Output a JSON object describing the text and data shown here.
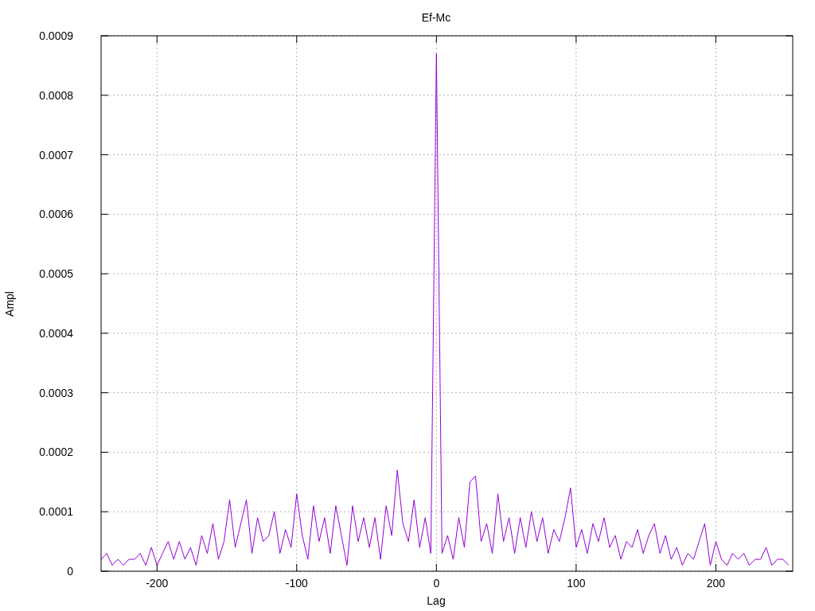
{
  "chart_data": {
    "type": "line",
    "grid": true,
    "title": "Ef-Mc",
    "xlabel": "Lag",
    "ylabel": "Ampl",
    "xlim": [
      -240,
      255
    ],
    "ylim": [
      0,
      0.0009
    ],
    "xticks": [
      -200,
      -100,
      0,
      100,
      200
    ],
    "yticks": [
      {
        "value": 0,
        "label": "0"
      },
      {
        "value": 0.0001,
        "label": "0.0001"
      },
      {
        "value": 0.0002,
        "label": "0.0002"
      },
      {
        "value": 0.0003,
        "label": "0.0003"
      },
      {
        "value": 0.0004,
        "label": "0.0004"
      },
      {
        "value": 0.0005,
        "label": "0.0005"
      },
      {
        "value": 0.0006,
        "label": "0.0006"
      },
      {
        "value": 0.0007,
        "label": "0.0007"
      },
      {
        "value": 0.0008,
        "label": "0.0008"
      },
      {
        "value": 0.0009,
        "label": "0.0009"
      }
    ],
    "x": [
      -240,
      -236,
      -232,
      -228,
      -224,
      -220,
      -216,
      -212,
      -208,
      -204,
      -200,
      -196,
      -192,
      -188,
      -184,
      -180,
      -176,
      -172,
      -168,
      -164,
      -160,
      -156,
      -152,
      -148,
      -144,
      -140,
      -136,
      -132,
      -128,
      -124,
      -120,
      -116,
      -112,
      -108,
      -104,
      -100,
      -96,
      -92,
      -88,
      -84,
      -80,
      -76,
      -72,
      -68,
      -64,
      -60,
      -56,
      -52,
      -48,
      -44,
      -40,
      -36,
      -32,
      -28,
      -24,
      -20,
      -16,
      -12,
      -8,
      -4,
      0,
      4,
      8,
      12,
      16,
      20,
      24,
      28,
      32,
      36,
      40,
      44,
      48,
      52,
      56,
      60,
      64,
      68,
      72,
      76,
      80,
      84,
      88,
      92,
      96,
      100,
      104,
      108,
      112,
      116,
      120,
      124,
      128,
      132,
      136,
      140,
      144,
      148,
      152,
      156,
      160,
      164,
      168,
      172,
      176,
      180,
      184,
      188,
      192,
      196,
      200,
      204,
      208,
      212,
      216,
      220,
      224,
      228,
      232,
      236,
      240,
      244,
      248,
      252
    ],
    "series": [
      {
        "color": "#9400d3",
        "values": [
          2e-05,
          3e-05,
          1e-05,
          2e-05,
          1e-05,
          2e-05,
          2e-05,
          3e-05,
          1e-05,
          4e-05,
          1e-05,
          3e-05,
          5e-05,
          2e-05,
          5e-05,
          2e-05,
          4e-05,
          1e-05,
          6e-05,
          3e-05,
          8e-05,
          2e-05,
          5e-05,
          0.00012,
          4e-05,
          8e-05,
          0.00012,
          3e-05,
          9e-05,
          5e-05,
          6e-05,
          0.0001,
          3e-05,
          7e-05,
          4e-05,
          0.00013,
          6e-05,
          2e-05,
          0.00011,
          5e-05,
          9e-05,
          3e-05,
          0.00011,
          6e-05,
          1e-05,
          0.00011,
          5e-05,
          9e-05,
          4e-05,
          9e-05,
          2e-05,
          0.00011,
          6e-05,
          0.00017,
          8e-05,
          5e-05,
          0.00012,
          4e-05,
          9e-05,
          3e-05,
          0.00087,
          3e-05,
          6e-05,
          2e-05,
          9e-05,
          4e-05,
          0.00015,
          0.00016,
          5e-05,
          8e-05,
          3e-05,
          0.00013,
          5e-05,
          9e-05,
          3e-05,
          9e-05,
          4e-05,
          0.0001,
          5e-05,
          9e-05,
          3e-05,
          7e-05,
          5e-05,
          9e-05,
          0.00014,
          4e-05,
          7e-05,
          3e-05,
          8e-05,
          5e-05,
          9e-05,
          4e-05,
          6e-05,
          2e-05,
          5e-05,
          4e-05,
          7e-05,
          3e-05,
          6e-05,
          8e-05,
          3e-05,
          6e-05,
          2e-05,
          4e-05,
          1e-05,
          3e-05,
          2e-05,
          5e-05,
          8e-05,
          1e-05,
          5e-05,
          2e-05,
          1e-05,
          3e-05,
          2e-05,
          3e-05,
          1e-05,
          2e-05,
          2e-05,
          4e-05,
          1e-05,
          2e-05,
          2e-05,
          1e-05
        ]
      }
    ]
  }
}
